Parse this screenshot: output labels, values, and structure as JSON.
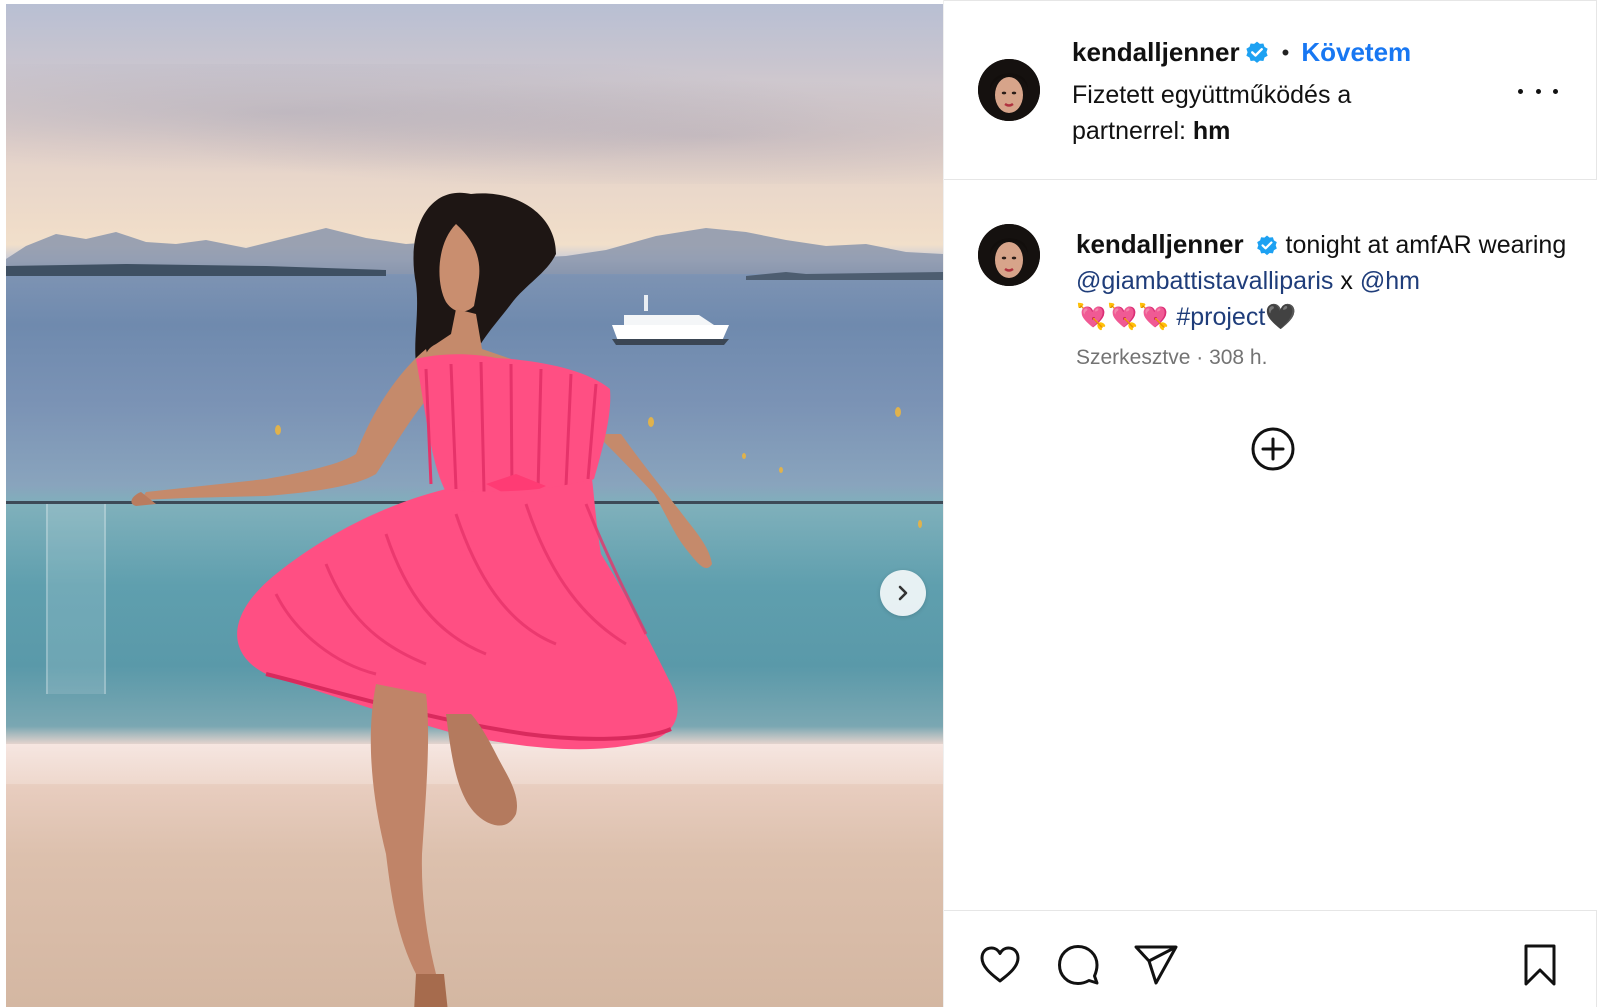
{
  "post": {
    "username": "kendalljenner",
    "follow_label": "Követem",
    "separator": "•",
    "paid_partnership_prefix": "Fizetett együttműködés a partnerrel:",
    "paid_partnership_partner": "hm"
  },
  "caption": {
    "username": "kendalljenner",
    "text_1": "tonight at amfAR wearing",
    "mention_1": "@giambattistavalliparis",
    "text_2": "x",
    "mention_2": "@hm",
    "emojis": "💘💘💘",
    "hashtag": "#project",
    "heart": "🖤",
    "edited_label": "Szerkesztve",
    "meta_separator": "·",
    "time_ago": "308 h."
  },
  "icons": {
    "next": "chevron-right-icon",
    "more": "more-options-icon",
    "verified": "verified-badge-icon",
    "add": "add-circle-icon",
    "like": "heart-icon",
    "comment": "comment-icon",
    "share": "share-icon",
    "save": "bookmark-icon"
  },
  "colors": {
    "accent": "#1877f2",
    "verified": "#1da1f2",
    "mention": "#1f3d7a",
    "dress": "#ff4f83"
  }
}
